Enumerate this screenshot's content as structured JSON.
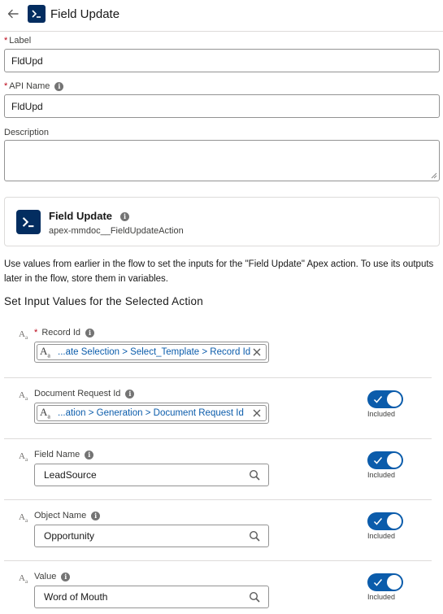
{
  "header": {
    "title": "Field Update",
    "back_icon": "back-arrow-icon",
    "app_icon": "apex-terminal-icon"
  },
  "label_field": {
    "label": "Label",
    "required": "*",
    "value": "FldUpd"
  },
  "api_name_field": {
    "label": "API Name",
    "required": "*",
    "value": "FldUpd",
    "info": "i"
  },
  "description_field": {
    "label": "Description",
    "value": ""
  },
  "action_card": {
    "title": "Field Update",
    "subtitle": "apex-mmdoc__FieldUpdateAction",
    "info": "i"
  },
  "intro_text": "Use values from earlier in the flow to set the inputs for the \"Field Update\" Apex action. To use its outputs later in the flow, store them in variables.",
  "section_title": "Set Input Values for the Selected Action",
  "type_icon_text": "A",
  "type_icon_sub": "a",
  "params": [
    {
      "label": "Record Id",
      "required": "*",
      "info": "i",
      "value": "...ate Selection > Select_Template > Record Id",
      "kind": "resource"
    },
    {
      "label": "Document Request Id",
      "info": "i",
      "value": "...ation > Generation > Document Request Id",
      "kind": "resource",
      "toggle_label": "Included",
      "toggle_on": true
    },
    {
      "label": "Field Name",
      "info": "i",
      "value": "LeadSource",
      "kind": "lookup",
      "toggle_label": "Included",
      "toggle_on": true
    },
    {
      "label": "Object Name",
      "info": "i",
      "value": "Opportunity",
      "kind": "lookup",
      "toggle_label": "Included",
      "toggle_on": true
    },
    {
      "label": "Value",
      "info": "i",
      "value": "Word of Mouth",
      "kind": "lookup",
      "toggle_label": "Included",
      "toggle_on": true
    }
  ],
  "colors": {
    "brand_dark": "#032d60",
    "toggle_on": "#0b5cab",
    "required": "#ba0517",
    "link": "#0b5cab"
  }
}
